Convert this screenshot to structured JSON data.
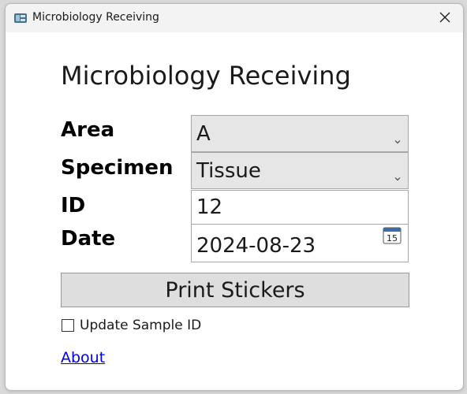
{
  "window": {
    "title": "Microbiology Receiving"
  },
  "main": {
    "heading": "Microbiology Receiving",
    "area": {
      "label": "Area",
      "value": "A"
    },
    "specimen": {
      "label": "Specimen",
      "value": "Tissue"
    },
    "id": {
      "label": "ID",
      "value": "12"
    },
    "date": {
      "label": "Date",
      "value": "2024-08-23",
      "calendar_day": "15"
    },
    "print_button": "Print Stickers",
    "update_sample_id": {
      "label": "Update Sample ID",
      "checked": false
    },
    "about_link": "About"
  },
  "colors": {
    "link": "#0000ee",
    "combo_background": "#e6e6e6",
    "button_background": "#dedede",
    "titlebar_background": "#f3f3f3"
  },
  "icons": {
    "app": "app-icon",
    "close": "close-icon",
    "dropdown": "chevron-down-icon",
    "calendar": "calendar-icon"
  }
}
